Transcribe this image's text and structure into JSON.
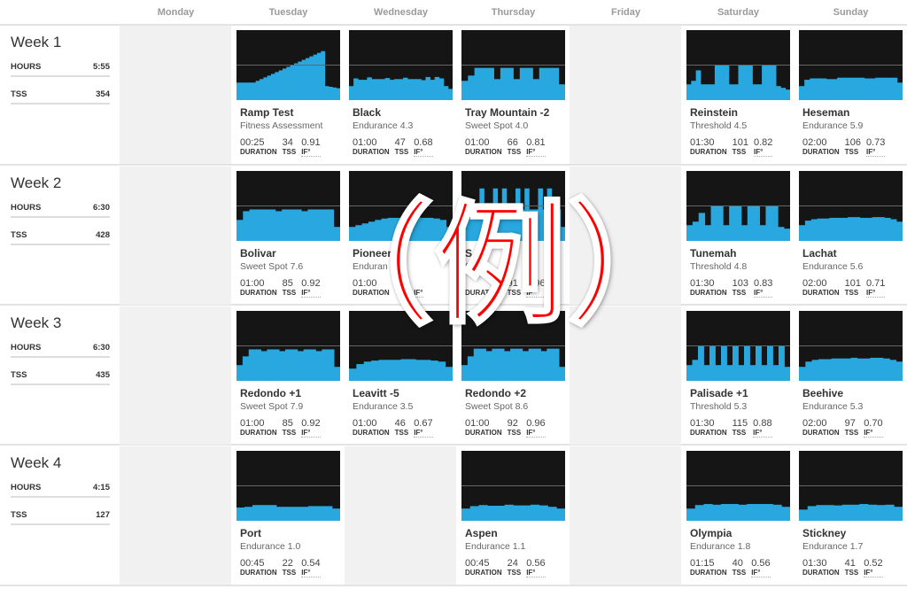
{
  "days": [
    "Monday",
    "Tuesday",
    "Wednesday",
    "Thursday",
    "Friday",
    "Saturday",
    "Sunday"
  ],
  "labels": {
    "hours": "HOURS",
    "tss": "TSS",
    "duration": "DURATION",
    "tss_stat": "TSS",
    "if_stat": "IF°"
  },
  "colors": {
    "profile": "#29a8e0",
    "chart_bg": "#151515",
    "ftp_line": "#666666",
    "empty_cell": "#f1f1f1",
    "overlay": "#ff0000"
  },
  "overlay_text": "（例）",
  "weeks": [
    {
      "title": "Week 1",
      "hours": "5:55",
      "tss": "354",
      "days": [
        null,
        {
          "name": "Ramp Test",
          "sub": "Fitness Assessment",
          "duration": "00:25",
          "tss": "34",
          "if": "0.91",
          "profile": [
            50,
            50,
            50,
            50,
            50,
            55,
            60,
            65,
            70,
            75,
            80,
            85,
            90,
            95,
            100,
            105,
            110,
            115,
            120,
            125,
            130,
            135,
            140,
            40,
            38,
            36,
            34
          ]
        },
        {
          "name": "Black",
          "sub": "Endurance 4.3",
          "duration": "01:00",
          "tss": "47",
          "if": "0.68",
          "profile": [
            40,
            62,
            58,
            58,
            65,
            60,
            60,
            60,
            63,
            58,
            60,
            60,
            64,
            60,
            60,
            60,
            57,
            66,
            58,
            66,
            62,
            40,
            32
          ]
        },
        {
          "name": "Tray Mountain -2",
          "sub": "Sweet Spot 4.0",
          "duration": "01:00",
          "tss": "66",
          "if": "0.81",
          "profile": [
            55,
            70,
            92,
            92,
            92,
            60,
            92,
            92,
            60,
            92,
            92,
            60,
            92,
            92,
            92,
            45
          ]
        },
        null,
        {
          "name": "Reinstein",
          "sub": "Threshold 4.5",
          "duration": "01:30",
          "tss": "101",
          "if": "0.82",
          "profile": [
            45,
            55,
            85,
            45,
            45,
            45,
            100,
            100,
            100,
            45,
            45,
            100,
            100,
            100,
            45,
            45,
            100,
            100,
            100,
            40,
            35,
            30
          ]
        },
        {
          "name": "Heseman",
          "sub": "Endurance 5.9",
          "duration": "02:00",
          "tss": "106",
          "if": "0.73",
          "profile": [
            40,
            58,
            62,
            62,
            62,
            60,
            60,
            64,
            64,
            64,
            64,
            64,
            62,
            62,
            64,
            64,
            64,
            64,
            50
          ]
        }
      ]
    },
    {
      "title": "Week 2",
      "hours": "6:30",
      "tss": "428",
      "days": [
        null,
        {
          "name": "Bolivar",
          "sub": "Sweet Spot 7.6",
          "duration": "01:00",
          "tss": "85",
          "if": "0.92",
          "profile": [
            60,
            85,
            90,
            90,
            90,
            90,
            85,
            90,
            90,
            90,
            85,
            90,
            90,
            90,
            90,
            40
          ]
        },
        {
          "name": "Pioneer",
          "sub": "Enduran",
          "duration": "01:00",
          "tss": "",
          "if": "",
          "profile": [
            40,
            45,
            50,
            55,
            60,
            64,
            66,
            66,
            68,
            66,
            68,
            66,
            66,
            64,
            60,
            40
          ]
        },
        {
          "name": "S",
          "sub": "S 8.5",
          "duration": "",
          "tss": "91",
          "if": "0.96",
          "profile": [
            40,
            65,
            80,
            90,
            150,
            90,
            90,
            150,
            90,
            150,
            90,
            90,
            150,
            90,
            150,
            90,
            90,
            150,
            90,
            150,
            90,
            90,
            40
          ]
        },
        null,
        {
          "name": "Tunemah",
          "sub": "Threshold 4.8",
          "duration": "01:30",
          "tss": "103",
          "if": "0.83",
          "profile": [
            45,
            55,
            80,
            45,
            100,
            100,
            45,
            100,
            100,
            45,
            100,
            100,
            45,
            100,
            100,
            40,
            35
          ]
        },
        {
          "name": "Lachat",
          "sub": "Endurance 5.6",
          "duration": "02:00",
          "tss": "101",
          "if": "0.71",
          "profile": [
            45,
            58,
            62,
            64,
            64,
            66,
            66,
            66,
            68,
            68,
            66,
            66,
            68,
            68,
            66,
            62,
            55
          ]
        }
      ]
    },
    {
      "title": "Week 3",
      "hours": "6:30",
      "tss": "435",
      "days": [
        null,
        {
          "name": "Redondo +1",
          "sub": "Sweet Spot 7.9",
          "duration": "01:00",
          "tss": "85",
          "if": "0.92",
          "profile": [
            45,
            70,
            90,
            90,
            85,
            90,
            90,
            85,
            90,
            90,
            85,
            90,
            90,
            85,
            90,
            90,
            40
          ]
        },
        {
          "name": "Leavitt -5",
          "sub": "Endurance 3.5",
          "duration": "01:00",
          "tss": "46",
          "if": "0.67",
          "profile": [
            35,
            48,
            55,
            58,
            60,
            60,
            60,
            62,
            62,
            60,
            60,
            58,
            55,
            40
          ]
        },
        {
          "name": "Redondo +2",
          "sub": "Sweet Spot 8.6",
          "duration": "01:00",
          "tss": "92",
          "if": "0.96",
          "profile": [
            45,
            70,
            92,
            92,
            85,
            92,
            92,
            85,
            92,
            92,
            85,
            92,
            92,
            85,
            92,
            92,
            40
          ]
        },
        null,
        {
          "name": "Palisade +1",
          "sub": "Threshold 5.3",
          "duration": "01:30",
          "tss": "115",
          "if": "0.88",
          "profile": [
            45,
            60,
            100,
            45,
            100,
            45,
            100,
            45,
            100,
            45,
            100,
            45,
            100,
            45,
            100,
            45,
            100,
            40
          ]
        },
        {
          "name": "Beehive",
          "sub": "Endurance 5.3",
          "duration": "02:00",
          "tss": "97",
          "if": "0.70",
          "profile": [
            40,
            55,
            60,
            62,
            62,
            64,
            64,
            64,
            66,
            64,
            64,
            66,
            66,
            64,
            60,
            55
          ]
        }
      ]
    },
    {
      "title": "Week 4",
      "hours": "4:15",
      "tss": "127",
      "days": [
        null,
        {
          "name": "Port",
          "sub": "Endurance 1.0",
          "duration": "00:45",
          "tss": "22",
          "if": "0.54",
          "profile": [
            38,
            40,
            45,
            45,
            45,
            40,
            40,
            40,
            40,
            42,
            42,
            42,
            35
          ]
        },
        null,
        {
          "name": "Aspen",
          "sub": "Endurance 1.1",
          "duration": "00:45",
          "tss": "24",
          "if": "0.56",
          "profile": [
            35,
            42,
            45,
            43,
            43,
            46,
            44,
            44,
            46,
            44,
            40,
            35
          ]
        },
        null,
        {
          "name": "Olympia",
          "sub": "Endurance 1.8",
          "duration": "01:15",
          "tss": "40",
          "if": "0.56",
          "profile": [
            35,
            45,
            48,
            46,
            48,
            48,
            46,
            48,
            48,
            48,
            46,
            40
          ]
        },
        {
          "name": "Stickney",
          "sub": "Endurance 1.7",
          "duration": "01:30",
          "tss": "41",
          "if": "0.52",
          "profile": [
            32,
            42,
            45,
            45,
            44,
            46,
            46,
            48,
            46,
            45,
            46,
            40
          ]
        }
      ]
    }
  ]
}
